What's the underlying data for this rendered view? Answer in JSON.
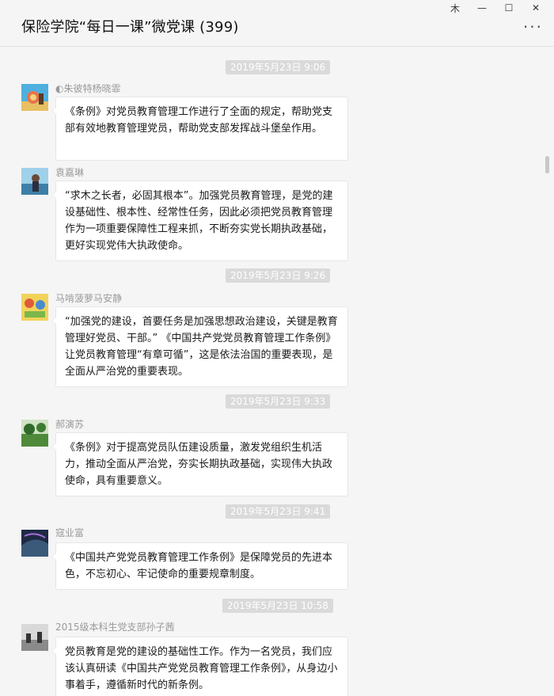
{
  "window": {
    "title": "保险学院“每日一课”微党课 (399)",
    "controls": {
      "pin": "⽊",
      "minimize": "—",
      "maximize": "☐",
      "close": "✕"
    },
    "more": "···"
  },
  "timestamps": [
    "2019年5月23日 9:06",
    "2019年5月23日 9:26",
    "2019年5月23日 9:33",
    "2019年5月23日 9:41",
    "2019年5月23日 10:58"
  ],
  "messages": [
    {
      "sender": "◐朱彼特杨晓霏",
      "text": "《条例》对党员教育管理工作进行了全面的规定，帮助党支部有效地教育管理党员，帮助党支部发挥战斗堡垒作用。"
    },
    {
      "sender": "袁嘉琳",
      "text": "“求木之长者，必固其根本”。加强党员教育管理，是党的建设基础性、根本性、经常性任务，因此必须把党员教育管理作为一项重要保障性工程来抓，不断夯实党长期执政基础，更好实现党伟大执政使命。"
    },
    {
      "sender": "马啃菠萝马安静",
      "text": "“加强党的建设，首要任务是加强思想政治建设，关键是教育管理好党员、干部。” 《中国共产党党员教育管理工作条例》让党员教育管理“有章可循”，这是依法治国的重要表现，是全面从严治党的重要表现。"
    },
    {
      "sender": "郝演苏",
      "text": "《条例》对于提高党员队伍建设质量，激发党组织生机活力，推动全面从严治党，夯实长期执政基础，实现伟大执政使命，具有重要意义。"
    },
    {
      "sender": "寇业富",
      "text": "《中国共产党党员教育管理工作条例》是保障党员的先进本色，不忘初心、牢记使命的重要规章制度。"
    },
    {
      "sender": "2015级本科生党支部孙子茜",
      "text": "党员教育是党的建设的基础性工作。作为一名党员，我们应该认真研读《中国共产党党员教育管理工作条例》，从身边小事着手，遵循新时代的新条例。"
    }
  ]
}
